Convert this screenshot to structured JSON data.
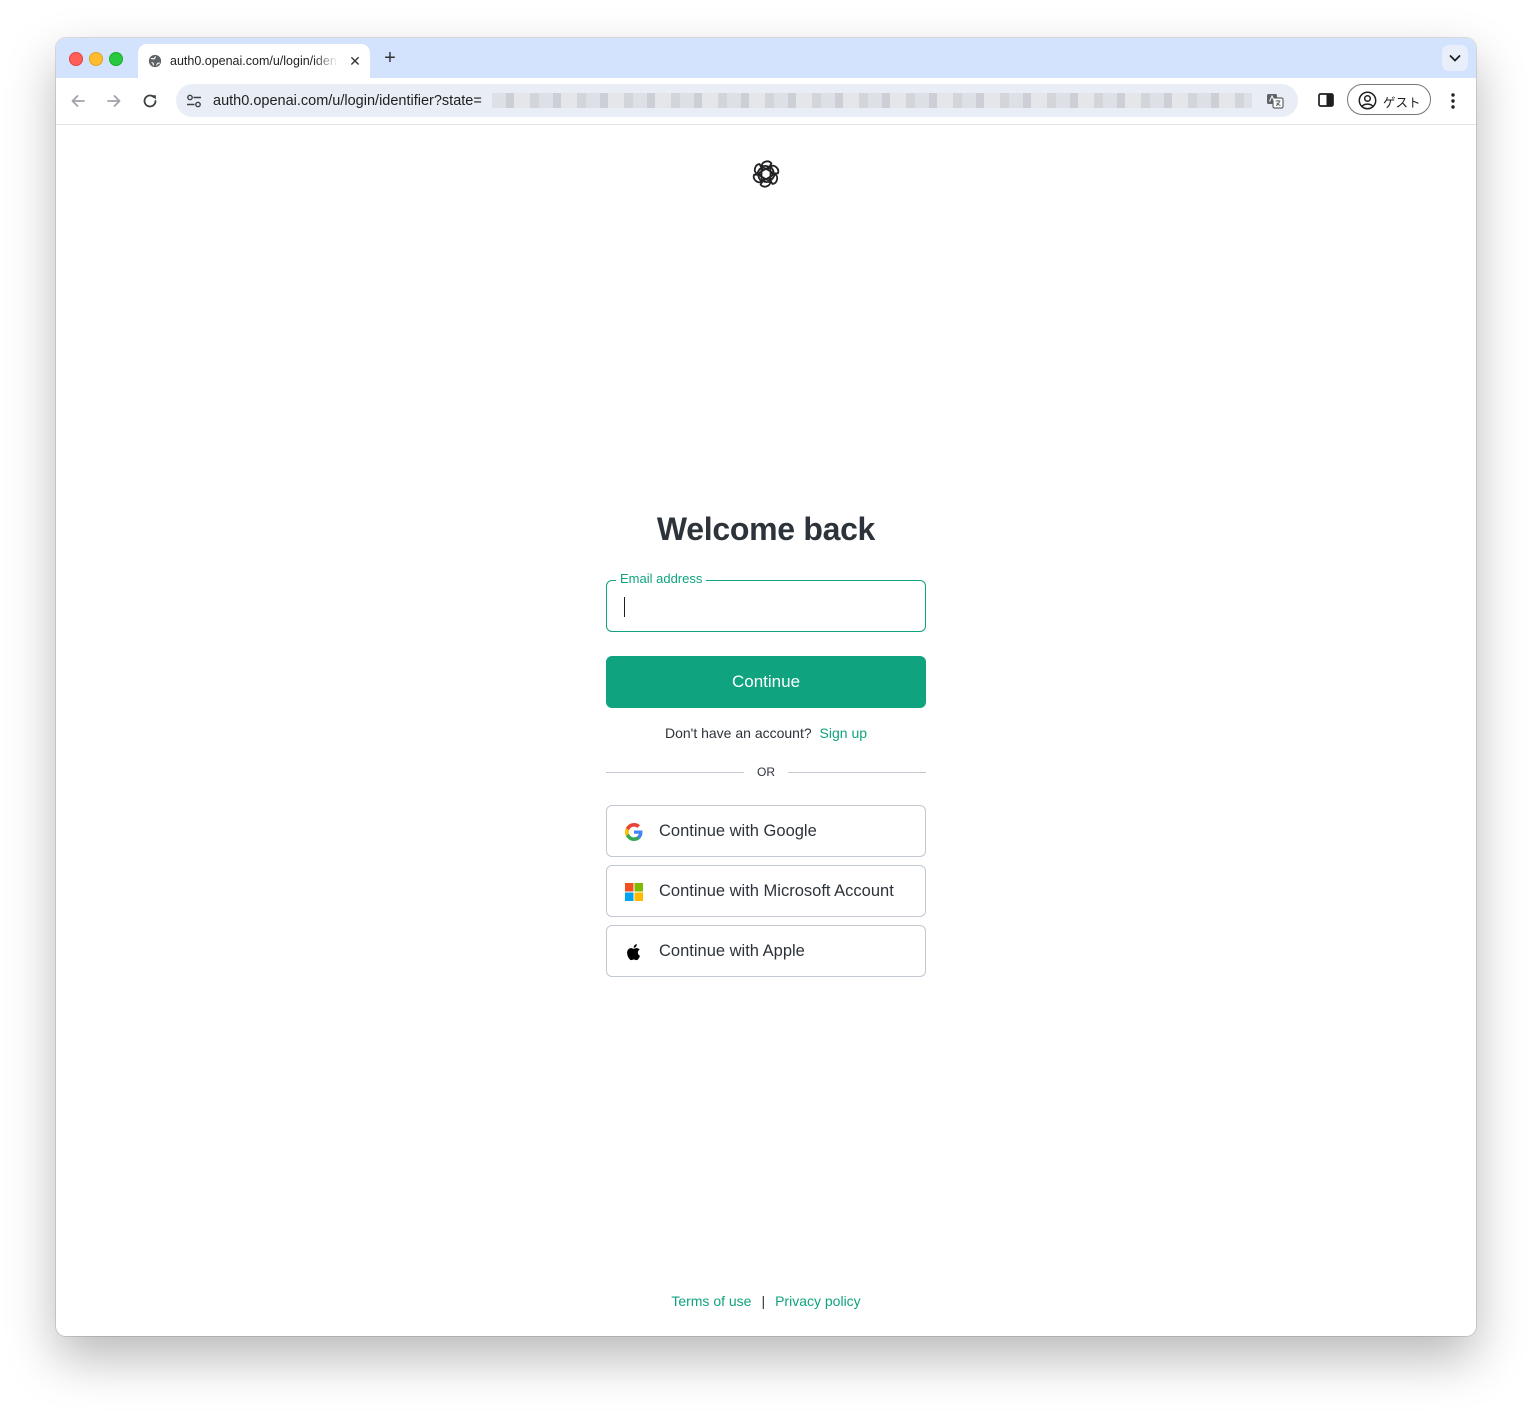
{
  "browser": {
    "tab_title": "auth0.openai.com/u/login/identifier",
    "url": "auth0.openai.com/u/login/identifier?state=",
    "profile_label": "ゲスト"
  },
  "page": {
    "heading": "Welcome back",
    "email": {
      "label": "Email address",
      "value": ""
    },
    "continue_label": "Continue",
    "signup_prompt": "Don't have an account?",
    "signup_link": "Sign up",
    "divider": "OR",
    "social": [
      {
        "label": "Continue with Google",
        "icon": "google-icon"
      },
      {
        "label": "Continue with Microsoft Account",
        "icon": "microsoft-icon"
      },
      {
        "label": "Continue with Apple",
        "icon": "apple-icon"
      }
    ],
    "footer": {
      "terms": "Terms of use",
      "separator": "|",
      "privacy": "Privacy policy"
    }
  },
  "colors": {
    "accent": "#10a37f",
    "heading_text": "#2d333a",
    "tab_strip": "#d3e3fd"
  }
}
